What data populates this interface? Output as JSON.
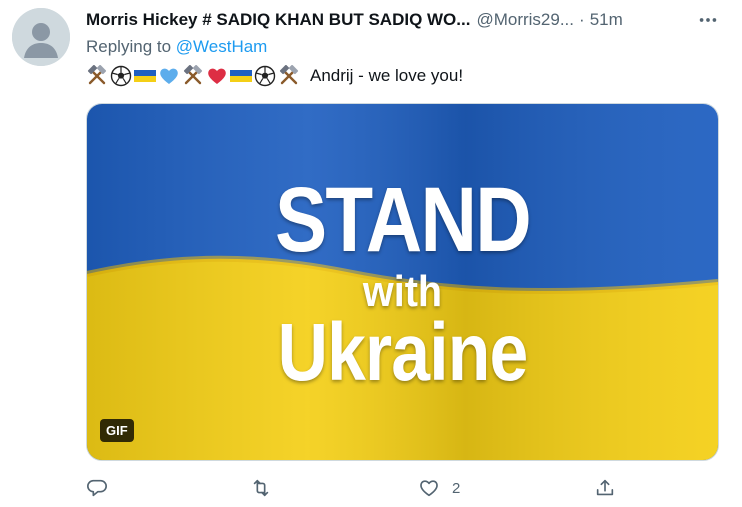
{
  "tweet": {
    "display_name": "Morris Hickey # SADIQ KHAN BUT SADIQ WO...",
    "handle": "@Morris29...",
    "separator": "·",
    "timestamp": "51m",
    "replying_prefix": "Replying to ",
    "replying_to": "@WestHam",
    "emojis": [
      "hammers-icon",
      "soccer-ball-icon",
      "ukraine-flag-icon",
      "blue-heart-icon",
      "hammers-icon",
      "red-heart-icon",
      "ukraine-flag-icon",
      "soccer-ball-icon",
      "hammers-icon"
    ],
    "text": "Andrij - we love you!",
    "media": {
      "line1": "STAND",
      "line2": "with",
      "line3": "Ukraine",
      "badge": "GIF",
      "colors": {
        "blue": "#1f5fc0",
        "yellow": "#f4cf16"
      }
    },
    "actions": {
      "reply_count": "",
      "retweet_count": "",
      "like_count": "2"
    }
  },
  "colors": {
    "link": "#1d9bf0",
    "muted": "#536471"
  }
}
